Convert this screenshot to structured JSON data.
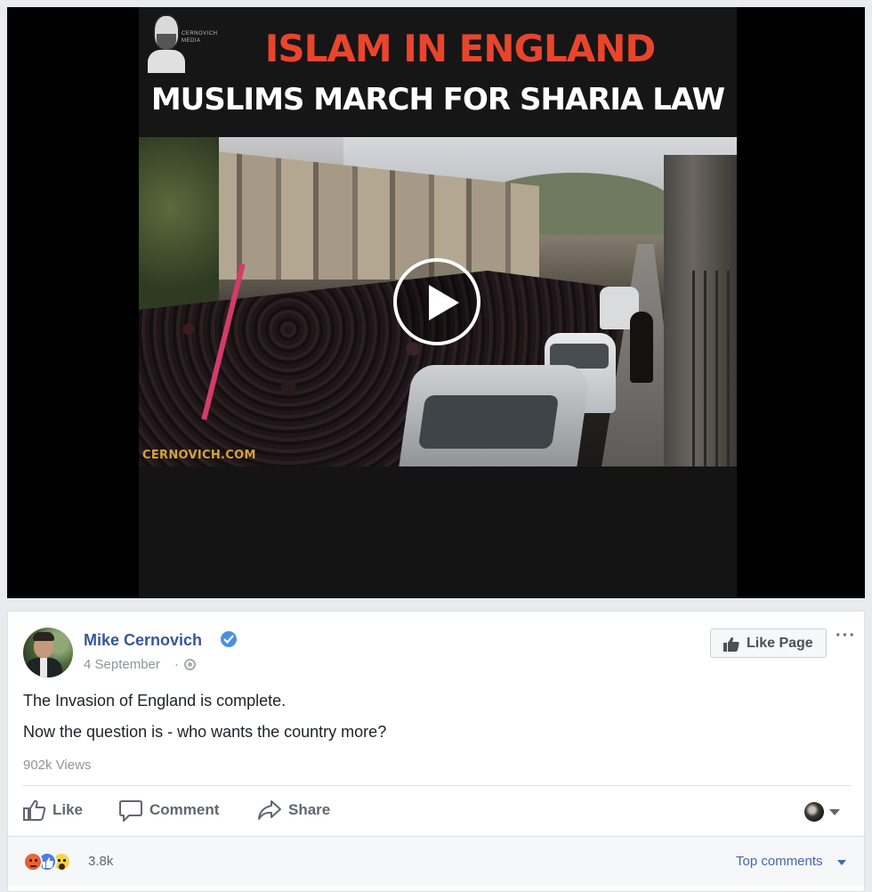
{
  "video": {
    "logo_text": "CERNOVICH\nMEDIA",
    "headline_1": "ISLAM IN ENGLAND",
    "headline_2": "MUSLIMS MARCH FOR SHARIA LAW",
    "watermark": "CERNOVICH.COM",
    "play_icon": "play-icon"
  },
  "post": {
    "author": "Mike Cernovich",
    "date": "4 September",
    "meta_separator": "·",
    "audience_icon": "globe-icon",
    "like_page_label": "Like Page",
    "more_label": "···",
    "text_line_1": "The Invasion of England is complete.",
    "text_line_2": "Now the question is - who wants the country more?",
    "views": "902k Views"
  },
  "actions": {
    "like": "Like",
    "comment": "Comment",
    "share": "Share"
  },
  "footer": {
    "reaction_icons": [
      "angry-icon",
      "like-icon",
      "wow-icon"
    ],
    "reaction_count": "3.8k",
    "sort_label": "Top comments"
  },
  "colors": {
    "link_blue": "#365899",
    "verified_blue": "#4a90e2",
    "headline_red": "#e8452c",
    "watermark_gold": "#d8a23a"
  }
}
